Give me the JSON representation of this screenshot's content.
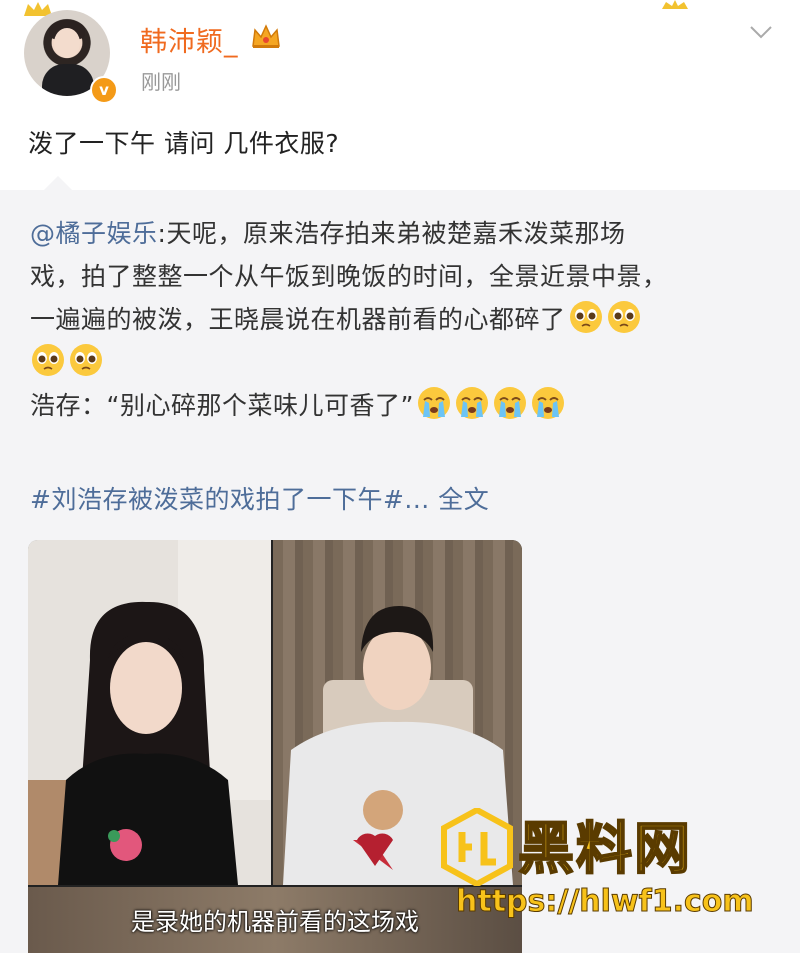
{
  "post": {
    "username": "韩沛颖_",
    "time": "刚刚",
    "text": "泼了一下午 请问 几件衣服?"
  },
  "repost": {
    "mention": "@橘子娱乐",
    "line1_rest": ":天呢，原来浩存拍来弟被楚嘉禾泼菜那场",
    "line2": "戏，拍了整整一个从午饭到晚饭的时间，全景近景中景，",
    "line3": "一遍遍的被泼，王晓晨说在机器前看的心都碎了",
    "line5": "浩存：“别心碎那个菜味儿可香了”",
    "hashtag": "#刘浩存被泼菜的戏拍了一下午#...",
    "full_text_link": "全文"
  },
  "video": {
    "caption": "是录她的机器前看的这场戏"
  },
  "watermark": {
    "brand": "黑料网",
    "url": "https://hlwf1.com"
  },
  "colors": {
    "username": "#f06a1f",
    "link": "#4e6d99",
    "repost_bg": "#f4f4f6",
    "watermark": "#f7c21a"
  },
  "icons": {
    "verified": "verified-badge-icon",
    "crown": "crown-icon",
    "menu": "chevron-down-icon",
    "emoji_pleading": "pleading-face-emoji",
    "emoji_crying": "crying-face-emoji"
  }
}
